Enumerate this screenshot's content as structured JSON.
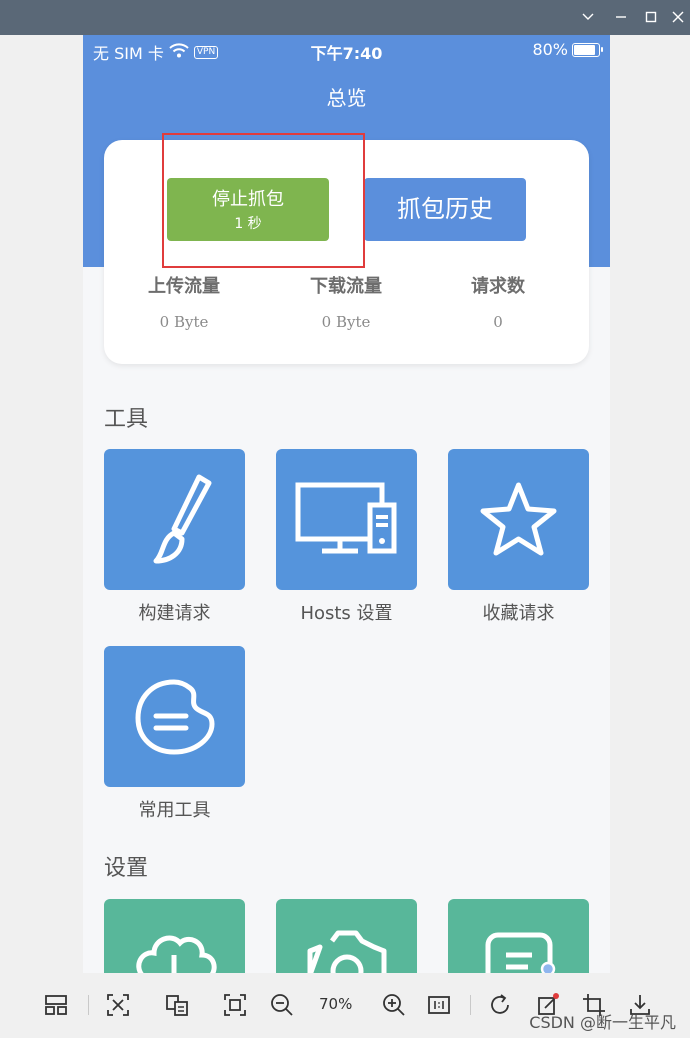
{
  "window": {
    "controls": [
      "chevron-down-icon",
      "minimize-icon",
      "maximize-icon",
      "close-icon"
    ]
  },
  "status_bar": {
    "carrier": "无 SIM 卡",
    "vpn": "VPN",
    "time": "下午7:40",
    "battery": "80%",
    "battery_level": 0.8
  },
  "nav": {
    "title": "总览"
  },
  "capture": {
    "stop_label": "停止抓包",
    "elapsed": "1 秒",
    "history_label": "抓包历史"
  },
  "stats": [
    {
      "label": "上传流量",
      "value": "0 Byte"
    },
    {
      "label": "下载流量",
      "value": "0 Byte"
    },
    {
      "label": "请求数",
      "value": "0"
    }
  ],
  "tools": {
    "title": "工具",
    "items": [
      {
        "label": "构建请求",
        "icon": "brush-icon"
      },
      {
        "label": "Hosts 设置",
        "icon": "computer-icon"
      },
      {
        "label": "收藏请求",
        "icon": "star-icon"
      },
      {
        "label": "常用工具",
        "icon": "palette-icon"
      }
    ]
  },
  "settings": {
    "title": "设置",
    "items": [
      {
        "icon": "cloud-icon"
      },
      {
        "icon": "gear-icon"
      },
      {
        "icon": "document-icon"
      }
    ]
  },
  "viewer": {
    "zoom": "70%",
    "watermark": "CSDN @断一生平凡"
  },
  "colors": {
    "primary": "#5b8fdc",
    "stop_green": "#7fb54f",
    "tile_blue": "#5594dc",
    "tile_green": "#58b79a",
    "highlight_red": "#e03c3c"
  }
}
